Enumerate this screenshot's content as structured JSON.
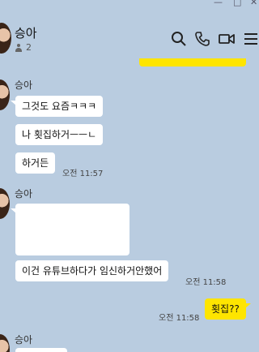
{
  "window": {
    "minimize": "—",
    "maximize": "□",
    "close": "✕"
  },
  "header": {
    "room_name": "승아",
    "member_count": "2"
  },
  "header_icons": [
    "search-icon",
    "phone-icon",
    "video-icon",
    "menu-icon"
  ],
  "colors": {
    "background": "#b9cce0",
    "my_bubble": "#fee500",
    "other_bubble": "#ffffff"
  },
  "messages": {
    "group1": {
      "sender": "승아",
      "m1": "그것도 요즘ㅋㅋㅋ",
      "m2": "나 횟집하거ㅡㅡㄴ",
      "m3": "하거든",
      "time": "오전 11:57"
    },
    "group2": {
      "sender": "승아",
      "m2": "이건 유튜브하다가 임신하거안했어",
      "time": "오전 11:58"
    },
    "mine": {
      "text": "횟집??",
      "time": "오전 11:58"
    },
    "group3": {
      "sender": "승아"
    }
  }
}
